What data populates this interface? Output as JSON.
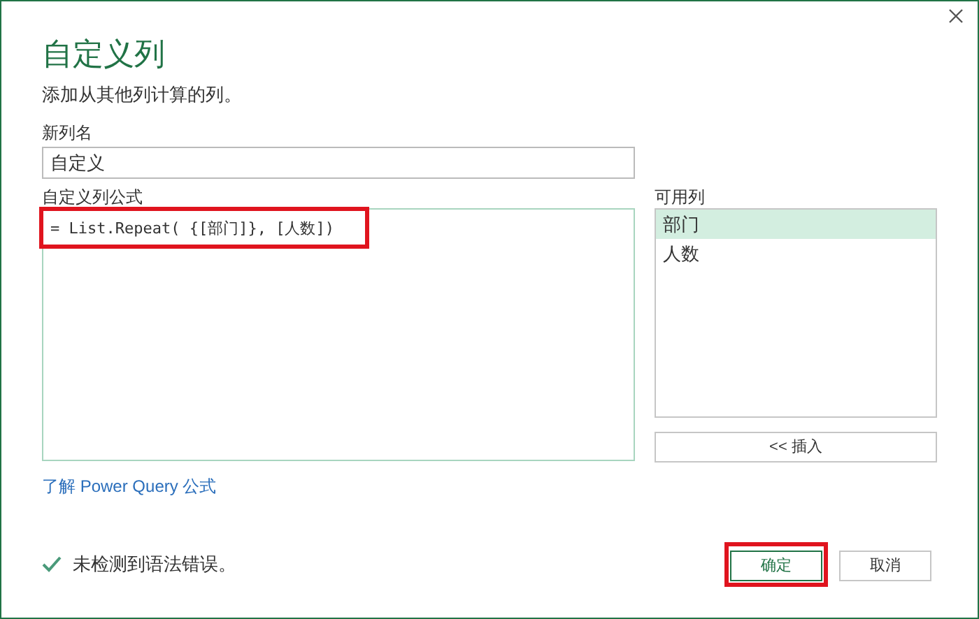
{
  "dialog": {
    "title": "自定义列",
    "description": "添加从其他列计算的列。"
  },
  "new_column": {
    "label": "新列名",
    "value": "自定义"
  },
  "formula": {
    "label": "自定义列公式",
    "value": "= List.Repeat( {[部门]}, [人数])",
    "highlighted": true
  },
  "available_columns": {
    "label": "可用列",
    "items": [
      {
        "label": "部门",
        "selected": true
      },
      {
        "label": "人数",
        "selected": false
      }
    ],
    "insert_button": "<< 插入"
  },
  "learn_link": "了解 Power Query 公式",
  "status": "未检测到语法错误。",
  "buttons": [
    {
      "label": "确定",
      "kind": "primary",
      "highlighted": true
    },
    {
      "label": "取消",
      "kind": "secondary",
      "highlighted": false
    }
  ]
}
